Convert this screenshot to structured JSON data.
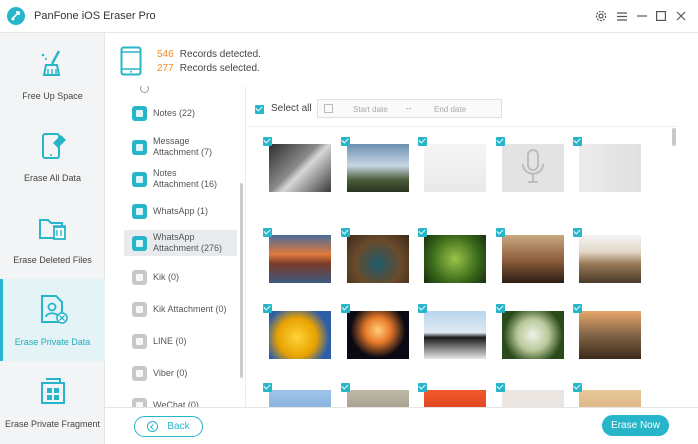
{
  "app": {
    "title": "PanFone iOS Eraser Pro"
  },
  "sidebar": {
    "items": [
      {
        "label": "Free Up Space",
        "icon": "broom-icon"
      },
      {
        "label": "Erase All Data",
        "icon": "phone-eraser-icon"
      },
      {
        "label": "Erase Deleted Files",
        "icon": "folder-trash-icon"
      },
      {
        "label": "Erase Private Data",
        "icon": "private-file-icon",
        "active": true
      },
      {
        "label": "Erase Private Fragment",
        "icon": "fragment-grid-icon"
      }
    ]
  },
  "records": {
    "detected_count": "546",
    "detected_label": "Records detected.",
    "selected_count": "277",
    "selected_label": "Records selected."
  },
  "categories": [
    {
      "label": "Notes (22)",
      "icon": "notes-icon",
      "color": "#27b5c9"
    },
    {
      "label": "Message\nAttachment (7)",
      "icon": "message-attachment-icon",
      "color": "#27b5c9"
    },
    {
      "label": "Notes\nAttachment (16)",
      "icon": "notes-attachment-icon",
      "color": "#27b5c9"
    },
    {
      "label": "WhatsApp (1)",
      "icon": "whatsapp-icon",
      "color": "#27b5c9"
    },
    {
      "label": "WhatsApp\nAttachment (276)",
      "icon": "whatsapp-attachment-icon",
      "color": "#27b5c9",
      "selected": true
    },
    {
      "label": "Kik (0)",
      "icon": "kik-icon",
      "color": "#c8c8c8"
    },
    {
      "label": "Kik Attachment (0)",
      "icon": "kik-attachment-icon",
      "color": "#c8c8c8"
    },
    {
      "label": "LINE (0)",
      "icon": "line-icon",
      "color": "#c8c8c8"
    },
    {
      "label": "Viber (0)",
      "icon": "viber-icon",
      "color": "#c8c8c8"
    },
    {
      "label": "WeChat (0)",
      "icon": "wechat-icon",
      "color": "#c8c8c8"
    }
  ],
  "toolbar": {
    "select_all_label": "Select all",
    "start_date_placeholder": "Start date",
    "date_separator": "--",
    "end_date_placeholder": "End date"
  },
  "photos": [
    {
      "name": "ceiling-photo",
      "bg": "linear-gradient(135deg,#2d2d2d,#8a8a8a 45%,#d8d8d8 55%,#3a3a3a)"
    },
    {
      "name": "cloud-landscape-photo",
      "bg": "linear-gradient(180deg,#6a8fb0 0%,#c9d7e4 45%,#4a5d3a 75%,#2a3320)"
    },
    {
      "name": "blurred-document-photo",
      "bg": "linear-gradient(180deg,#f5f5f5,#e9e9e9)"
    },
    {
      "name": "audio-placeholder",
      "bg": "#e3e3e3"
    },
    {
      "name": "blurred-light-photo",
      "bg": "linear-gradient(90deg,#ececec,#e0e0e0)"
    },
    {
      "name": "mountain-lake-photo",
      "bg": "linear-gradient(180deg,#4a6c9a 0%,#e07a3b 40%,#7a3a2a 60%,#3d5a80)"
    },
    {
      "name": "peacock-photo",
      "bg": "radial-gradient(circle at 50% 60%,#1d5a6a,#6b4a2a 55%,#3a2a1a)"
    },
    {
      "name": "green-leaf-photo",
      "bg": "radial-gradient(circle at 50% 50%,#9bc24a,#3a6a1a 60%,#1a2e0d)"
    },
    {
      "name": "sunset-city-photo",
      "bg": "linear-gradient(180deg,#c9a882 0%,#8a5a3a 55%,#2a1e14)"
    },
    {
      "name": "colosseum-photo",
      "bg": "linear-gradient(180deg,#f4f4f4 0%,#e2d8c8 35%,#9a7a58 60%,#4a3a2a)"
    },
    {
      "name": "yellow-flowers-photo",
      "bg": "radial-gradient(circle at 45% 55%,#ffd33a,#e8a200 45%,#2f5ea8 75%)"
    },
    {
      "name": "jellyfish-photo",
      "bg": "radial-gradient(circle at 50% 40%,#ffcf7a,#e87a2a 30%,#0a0a14 65%)"
    },
    {
      "name": "penguins-photo",
      "bg": "linear-gradient(180deg,#b8d6ef 0%,#dfe9f2 45%,#1a1a1a 55%,#e8e8e8)"
    },
    {
      "name": "white-flower-photo",
      "bg": "radial-gradient(circle at 50% 50%,#f2f2e8,#b8c89a 40%,#2a4a1a 75%)"
    },
    {
      "name": "castle-photo",
      "bg": "linear-gradient(180deg,#e8a66a 0%,#8a6a4a 45%,#3a2a1a)"
    },
    {
      "name": "sky-photo",
      "bg": "linear-gradient(180deg,#9ec4e8,#6a9acc)"
    },
    {
      "name": "koala-photo",
      "bg": "linear-gradient(180deg,#bfb9a8,#7f7768)"
    },
    {
      "name": "red-tulips-photo",
      "bg": "linear-gradient(180deg,#f05a2a,#c22a14)"
    },
    {
      "name": "blurred-photo",
      "bg": "#ebe6e2"
    },
    {
      "name": "desert-photo",
      "bg": "linear-gradient(180deg,#e8c89a,#c99a6a)"
    }
  ],
  "footer": {
    "back_label": "Back",
    "erase_label": "Erase Now"
  },
  "colors": {
    "accent": "#27b5c9",
    "orange": "#f28c2a"
  }
}
